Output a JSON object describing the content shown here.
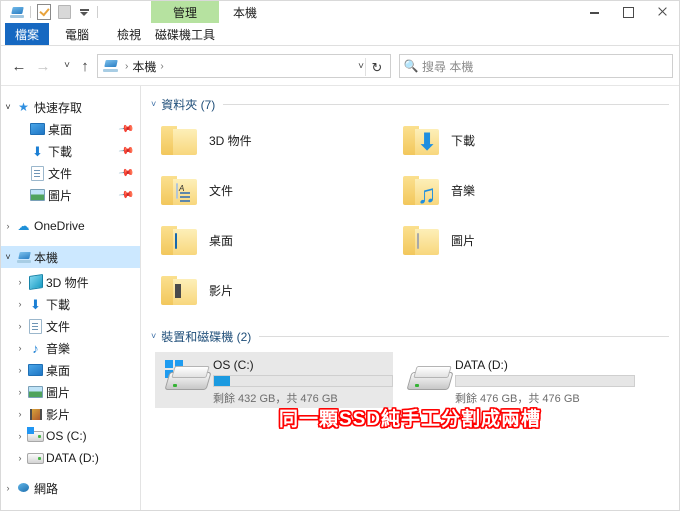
{
  "window": {
    "title": "本機",
    "contextual_tab": "管理",
    "quick_access_toolbar": [
      {
        "name": "this-pc-icon",
        "label": "本機"
      },
      {
        "name": "properties-icon",
        "label": "內容"
      },
      {
        "name": "new-folder-icon",
        "label": "新增資料夾"
      },
      {
        "name": "customize-qat-icon",
        "label": "自訂快速存取工具列"
      }
    ],
    "buttons": {
      "minimize": "最小化",
      "maximize": "最大化",
      "close": "關閉"
    }
  },
  "ribbon": {
    "tabs": [
      {
        "label": "檔案",
        "active": true
      },
      {
        "label": "電腦",
        "active": false
      },
      {
        "label": "檢視",
        "active": false
      },
      {
        "label": "磁碟機工具",
        "active": false
      }
    ]
  },
  "navigation": {
    "back": "←",
    "forward": "→",
    "recent": "˅",
    "up": "↑",
    "refresh": "↻",
    "address": {
      "crumb": "本機",
      "separator": "›",
      "dropdown": "˅"
    },
    "search": {
      "placeholder": "搜尋 本機",
      "icon": "search-icon"
    }
  },
  "sidebar": {
    "items": [
      {
        "label": "快速存取",
        "icon": "star-icon",
        "chevron": "˅",
        "indent": 0,
        "pinned": false,
        "selected": false
      },
      {
        "label": "桌面",
        "icon": "desktop-icon",
        "chevron": "",
        "indent": 1,
        "pinned": true,
        "selected": false
      },
      {
        "label": "下載",
        "icon": "download-icon",
        "chevron": "",
        "indent": 1,
        "pinned": true,
        "selected": false
      },
      {
        "label": "文件",
        "icon": "document-icon",
        "chevron": "",
        "indent": 1,
        "pinned": true,
        "selected": false
      },
      {
        "label": "圖片",
        "icon": "pictures-icon",
        "chevron": "",
        "indent": 1,
        "pinned": true,
        "selected": false
      },
      {
        "label": "OneDrive",
        "icon": "cloud-icon",
        "chevron": "›",
        "indent": 0,
        "pinned": false,
        "selected": false
      },
      {
        "label": "本機",
        "icon": "this-pc-icon",
        "chevron": "˅",
        "indent": 0,
        "pinned": false,
        "selected": true
      },
      {
        "label": "3D 物件",
        "icon": "3d-objects-icon",
        "chevron": "›",
        "indent": 1,
        "pinned": false,
        "selected": false
      },
      {
        "label": "下載",
        "icon": "download-icon",
        "chevron": "›",
        "indent": 1,
        "pinned": false,
        "selected": false
      },
      {
        "label": "文件",
        "icon": "document-icon",
        "chevron": "›",
        "indent": 1,
        "pinned": false,
        "selected": false
      },
      {
        "label": "音樂",
        "icon": "music-icon",
        "chevron": "›",
        "indent": 1,
        "pinned": false,
        "selected": false
      },
      {
        "label": "桌面",
        "icon": "desktop-icon",
        "chevron": "›",
        "indent": 1,
        "pinned": false,
        "selected": false
      },
      {
        "label": "圖片",
        "icon": "pictures-icon",
        "chevron": "›",
        "indent": 1,
        "pinned": false,
        "selected": false
      },
      {
        "label": "影片",
        "icon": "videos-icon",
        "chevron": "›",
        "indent": 1,
        "pinned": false,
        "selected": false
      },
      {
        "label": "OS (C:)",
        "icon": "windows-drive-icon",
        "chevron": "›",
        "indent": 1,
        "pinned": false,
        "selected": false
      },
      {
        "label": "DATA (D:)",
        "icon": "drive-icon",
        "chevron": "›",
        "indent": 1,
        "pinned": false,
        "selected": false
      },
      {
        "label": "網路",
        "icon": "network-icon",
        "chevron": "›",
        "indent": 0,
        "pinned": false,
        "selected": false
      }
    ]
  },
  "content": {
    "groups": [
      {
        "title": "資料夾 (7)",
        "chevron": "˅"
      },
      {
        "title": "裝置和磁碟機 (2)",
        "chevron": "˅"
      }
    ],
    "folders": [
      {
        "name": "3D 物件",
        "icon": "folder-3d-objects-icon"
      },
      {
        "name": "下載",
        "icon": "folder-downloads-icon"
      },
      {
        "name": "文件",
        "icon": "folder-documents-icon"
      },
      {
        "name": "音樂",
        "icon": "folder-music-icon"
      },
      {
        "name": "桌面",
        "icon": "folder-desktop-icon"
      },
      {
        "name": "圖片",
        "icon": "folder-pictures-icon"
      },
      {
        "name": "影片",
        "icon": "folder-videos-icon"
      }
    ],
    "drives": [
      {
        "name": "OS (C:)",
        "meta": "剩餘 432 GB，共 476 GB",
        "free_gb": 432,
        "total_gb": 476,
        "used_percent": 9,
        "icon": "windows-drive-icon",
        "selected": true,
        "bar_color": "#1b9ae0"
      },
      {
        "name": "DATA (D:)",
        "meta": "剩餘 476 GB，共 476 GB",
        "free_gb": 476,
        "total_gb": 476,
        "used_percent": 0,
        "icon": "drive-icon",
        "selected": false,
        "bar_color": "#1b9ae0"
      }
    ],
    "annotation": {
      "text": "同一顆SSD純手工分割成兩槽",
      "color": "#ff0000"
    }
  }
}
